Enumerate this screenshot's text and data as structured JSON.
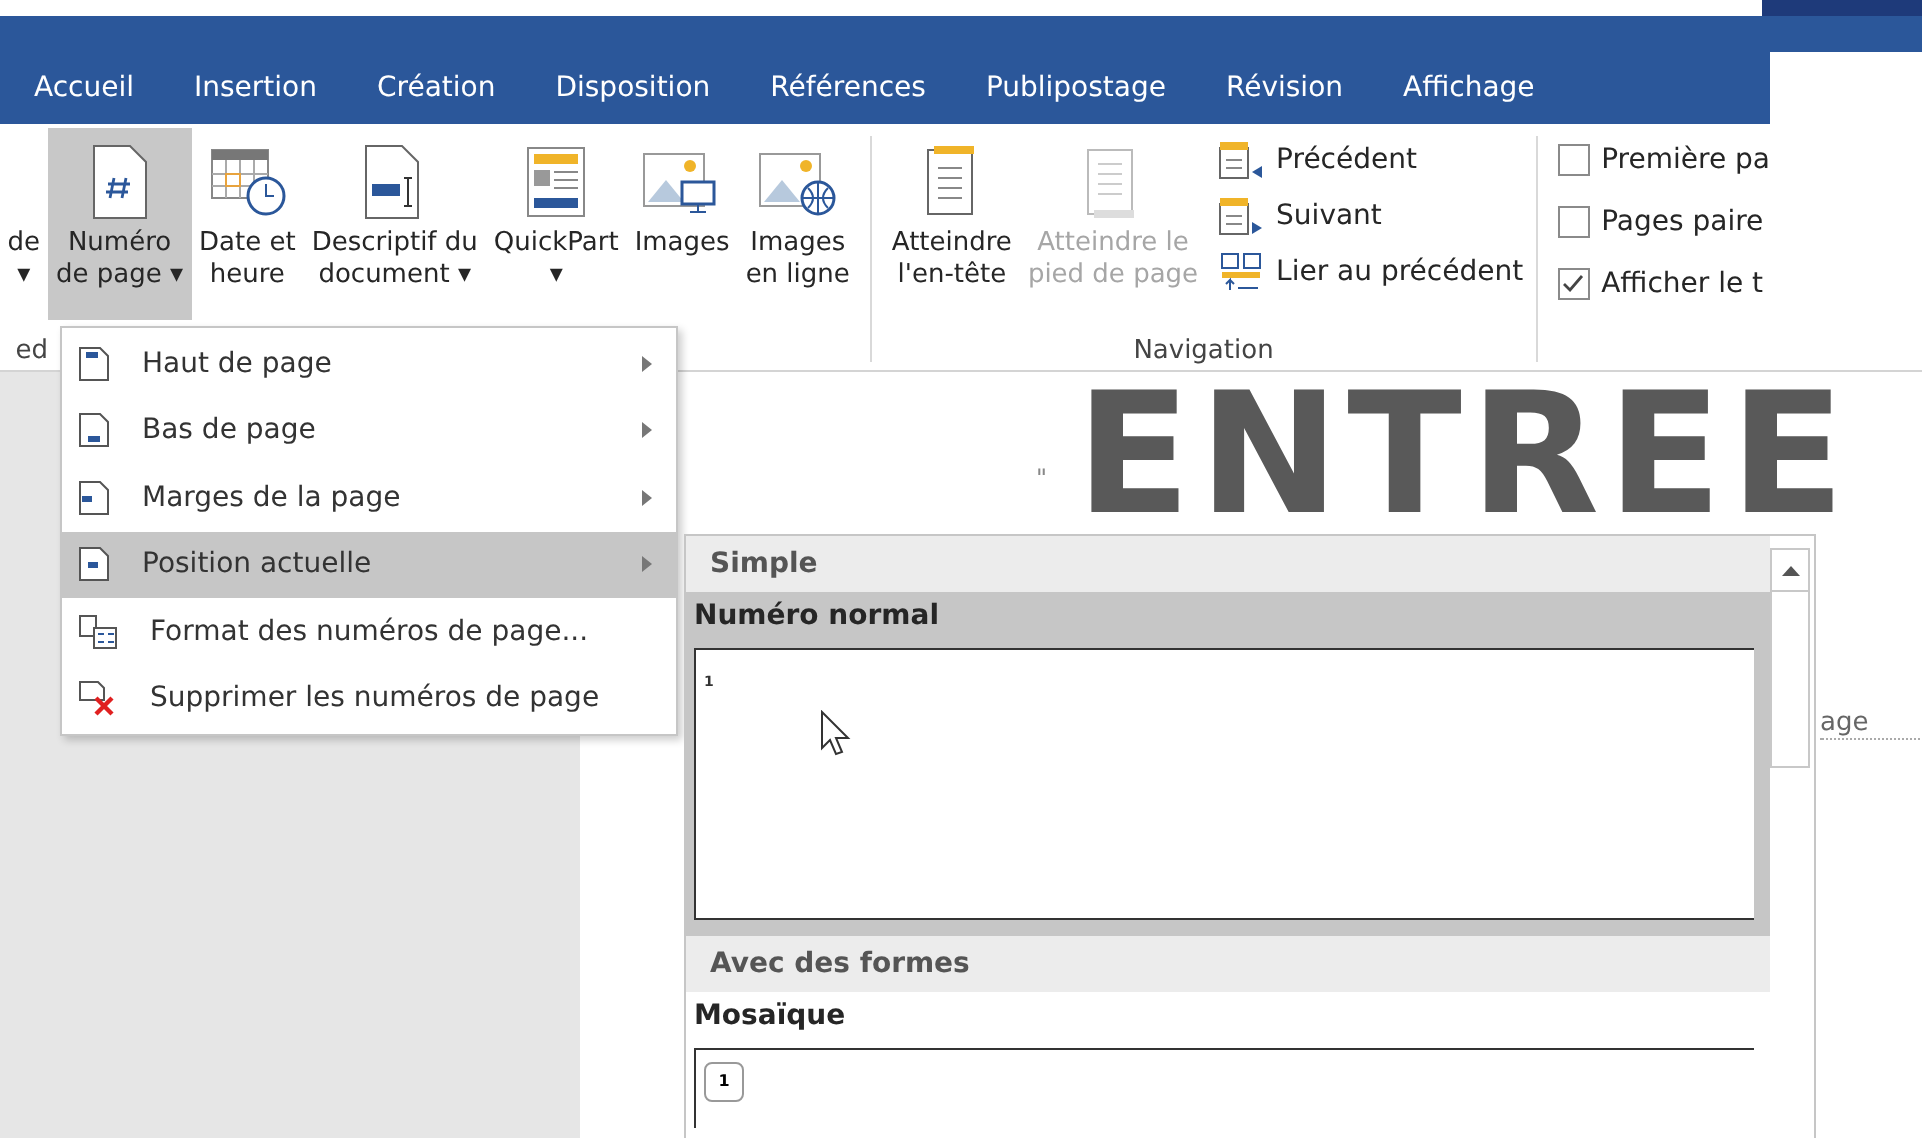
{
  "tabs": [
    {
      "label": "Accueil",
      "selected": false
    },
    {
      "label": "Insertion",
      "selected": false
    },
    {
      "label": "Création",
      "selected": false
    },
    {
      "label": "Disposition",
      "selected": false
    },
    {
      "label": "Références",
      "selected": false
    },
    {
      "label": "Publipostage",
      "selected": false
    },
    {
      "label": "Révision",
      "selected": false
    },
    {
      "label": "Affichage",
      "selected": false
    }
  ],
  "ribbon": {
    "cut_button": {
      "line_1": "de",
      "line_2": "▾"
    },
    "cut_group_label": "ed",
    "buttons": [
      {
        "kind": "page-number",
        "line_1": "Numéro",
        "line_2": "de page ▾",
        "selected": true,
        "disabled": false
      },
      {
        "kind": "date",
        "line_1": "Date et",
        "line_2": "heure",
        "selected": false,
        "disabled": false
      },
      {
        "kind": "doc-info",
        "line_1": "Descriptif du",
        "line_2": "document ▾",
        "selected": false,
        "disabled": false
      },
      {
        "kind": "quickpart",
        "line_1": "QuickPart",
        "line_2": "▾",
        "selected": false,
        "disabled": false
      },
      {
        "kind": "images",
        "line_1": "Images",
        "selected": false,
        "disabled": false
      },
      {
        "kind": "online-images",
        "line_1": "Images",
        "line_2": "en ligne",
        "selected": false,
        "disabled": false
      }
    ],
    "navigation": {
      "label": "Navigation",
      "buttons": [
        {
          "kind": "header",
          "line_1": "Atteindre",
          "line_2": "l'en-tête",
          "disabled": false
        },
        {
          "kind": "footer",
          "line_1": "Atteindre le",
          "line_2": "pied de page",
          "disabled": true
        }
      ],
      "small": [
        {
          "kind": "previous",
          "label": "Précédent"
        },
        {
          "kind": "next",
          "label": "Suivant"
        },
        {
          "kind": "link",
          "label": "Lier au précédent"
        }
      ]
    },
    "options": [
      {
        "label": "Première pa",
        "checked": false
      },
      {
        "label": "Pages paire",
        "checked": false
      },
      {
        "label": "Afficher le t",
        "checked": true
      }
    ]
  },
  "document": {
    "heading": "ENTREE",
    "mark": "\"",
    "footer_text": "age"
  },
  "menu": [
    {
      "kind": "top",
      "label": "Haut de page",
      "submenu": true,
      "selected": false
    },
    {
      "kind": "bottom",
      "label": "Bas de page",
      "submenu": true,
      "selected": false
    },
    {
      "kind": "margin",
      "label": "Marges de la page",
      "submenu": true,
      "selected": false
    },
    {
      "kind": "current",
      "label": "Position actuelle",
      "submenu": true,
      "selected": true
    },
    {
      "kind": "format",
      "label": "Format des numéros de page...",
      "submenu": false,
      "selected": false
    },
    {
      "kind": "remove",
      "label": "Supprimer les numéros de page",
      "submenu": false,
      "selected": false
    }
  ],
  "gallery": {
    "sections": [
      {
        "title": "Simple",
        "items": [
          {
            "name": "Numéro normal",
            "preview": "1",
            "selected": true
          }
        ]
      },
      {
        "title": "Avec des formes",
        "items": [
          {
            "name": "Mosaïque",
            "preview": "1",
            "selected": false
          }
        ]
      }
    ]
  }
}
